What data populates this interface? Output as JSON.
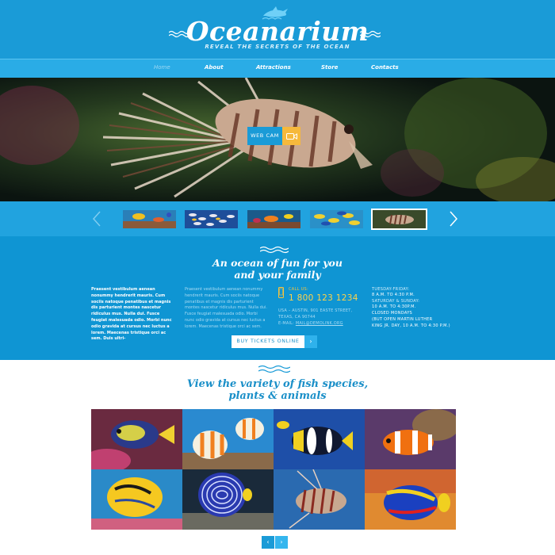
{
  "header": {
    "logo": "Oceanarium",
    "tagline": "REVEAL THE SECRETS OF THE OCEAN"
  },
  "nav": {
    "items": [
      "Home",
      "About",
      "Attractions",
      "Store",
      "Contacts"
    ],
    "active": "Home"
  },
  "hero": {
    "webcam_label": "WEB CAM"
  },
  "thumbnails": {
    "count": 5,
    "active_index": 4
  },
  "info": {
    "title_line1": "An ocean of fun for you",
    "title_line2": "and your family",
    "col1_text": "Praesent vestibulum aenean nonummy hendrerit mauris. Cum sociis natoque penatibus et magnis dis parturient montes nascetur ridiculus mus. Nulla dui. Fusce feugiat malesuada odio. Morbi nunc odio gravida at cursus nec luctus a lorem. Maecenas tristique orci ac sem. Duis ultri-",
    "col2_text": "Praesent vestibulum aenean nonummy hendrerit mauris. Cum sociis natoque penatibus et magnis dis parturient montes nascetur ridiculus mus. Nulla dui. Fusce feugiat malesuada odio. Morbi nunc odio gravida at cursus nec luctus a lorem. Maecenas tristique orci ac sem.",
    "call_label": "CALL US:",
    "phone": "1 800 123 1234",
    "address_line1": "USA – AUSTIN, 901 EASTE STREET,",
    "address_line2": "TEXAS, CA 90744",
    "email_label": "E-MAIL:",
    "email": "MAIL@DEMOLINK.ORG",
    "hours_weekday_label": "TUESDAY-FRIDAY:",
    "hours_weekday": "8 A.M. TO 4:30 P.M.",
    "hours_weekend_label": "SATURDAY & SUNDAY:",
    "hours_weekend": "10 A.M. TO 4:30P.M.",
    "closed_line1": "CLOSED MONDAYS",
    "closed_line2": "(BUT OPEN MARTIN LUTHER",
    "closed_line3": "KING JR. DAY, 10 A.M. TO 4:30 P.M.)",
    "buy_button": "BUY TICKETS ONLINE",
    "buy_arrow": "›"
  },
  "species": {
    "title_line1": "View the variety of fish species,",
    "title_line2": "plants & animals",
    "pager_prev": "‹",
    "pager_next": "›"
  },
  "colors": {
    "primary": "#1a9bd7",
    "nav": "#2aace6",
    "info_bg": "#0f95d3",
    "accent_yellow": "#f6b93c",
    "title_blue": "#1a8fc8"
  }
}
